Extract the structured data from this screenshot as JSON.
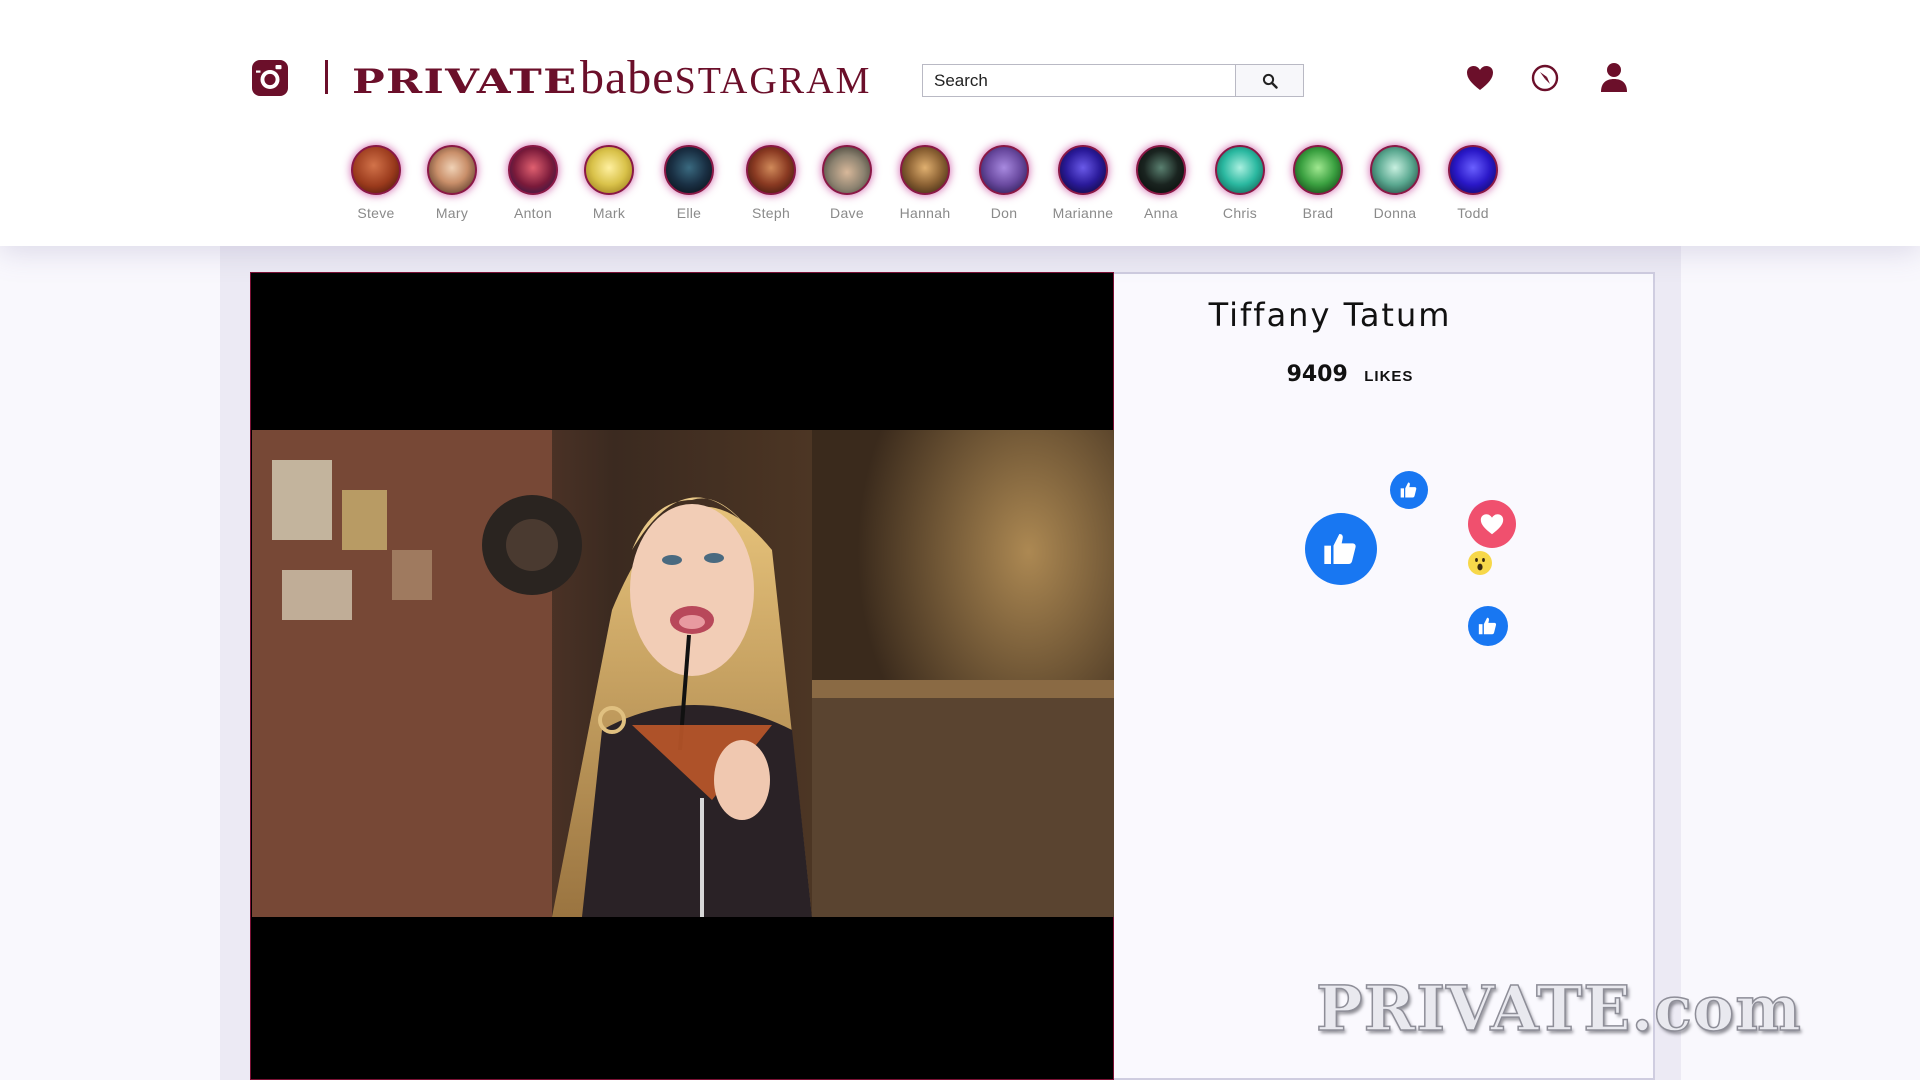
{
  "header": {
    "brand_private": "PRIVATE",
    "brand_babe": "babe",
    "brand_stagram": "STAGRAM",
    "search": {
      "placeholder": "Search"
    },
    "nav_icons": [
      "heart-icon",
      "compass-icon",
      "user-icon"
    ]
  },
  "stories": [
    {
      "name": "Steve",
      "color": "#9a3a1c"
    },
    {
      "name": "Mary",
      "color": "#c98f6a"
    },
    {
      "name": "Anton",
      "color": "#7a1a3a"
    },
    {
      "name": "Mark",
      "color": "#d9c24a"
    },
    {
      "name": "Elle",
      "color": "#1a3044"
    },
    {
      "name": "Steph",
      "color": "#8a3a22"
    },
    {
      "name": "Dave",
      "color": "#8c8270"
    },
    {
      "name": "Hannah",
      "color": "#8c6234"
    },
    {
      "name": "Don",
      "color": "#6a4aa0"
    },
    {
      "name": "Marianne",
      "color": "#2a1a9a"
    },
    {
      "name": "Anna",
      "color": "#1a2420"
    },
    {
      "name": "Chris",
      "color": "#2ab8a0"
    },
    {
      "name": "Brad",
      "color": "#3aa040"
    },
    {
      "name": "Donna",
      "color": "#5aa890"
    },
    {
      "name": "Todd",
      "color": "#2a18c8"
    }
  ],
  "post": {
    "model_name": "Tiffany Tatum",
    "likes_count": "9409",
    "likes_label": "LIKES"
  },
  "reactions": [
    "thumbs-up-icon",
    "thumbs-up-icon",
    "heart-icon",
    "wow-emoji-icon",
    "thumbs-up-icon"
  ],
  "colors": {
    "brand": "#6b0f2a",
    "reaction_blue": "#1877f2",
    "reaction_red": "#f0506e",
    "story_ring": "#8a1846"
  },
  "watermark": "PRIVATE.com"
}
